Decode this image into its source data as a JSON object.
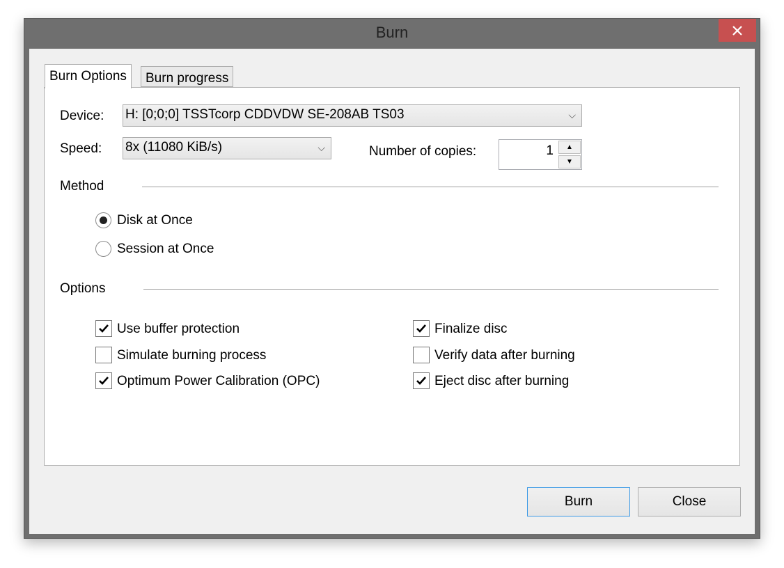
{
  "window": {
    "title": "Burn",
    "close_icon": "close-icon"
  },
  "tabs": [
    {
      "label": "Burn Options",
      "active": true
    },
    {
      "label": "Burn progress",
      "active": false
    }
  ],
  "device": {
    "label": "Device:",
    "value": "H:  [0;0;0] TSSTcorp CDDVDW SE-208AB TS03"
  },
  "speed": {
    "label": "Speed:",
    "value": "8x (11080 KiB/s)"
  },
  "copies": {
    "label": "Number of copies:",
    "value": "1"
  },
  "method": {
    "heading": "Method",
    "options": [
      {
        "label": "Disk at Once",
        "selected": true
      },
      {
        "label": "Session at Once",
        "selected": false
      }
    ]
  },
  "options": {
    "heading": "Options",
    "left": [
      {
        "label": "Use buffer protection",
        "checked": true
      },
      {
        "label": "Simulate burning process",
        "checked": false
      },
      {
        "label": "Optimum Power Calibration (OPC)",
        "checked": true
      }
    ],
    "right": [
      {
        "label": "Finalize disc",
        "checked": true
      },
      {
        "label": "Verify data after burning",
        "checked": false
      },
      {
        "label": "Eject disc after burning",
        "checked": true
      }
    ]
  },
  "buttons": {
    "burn": "Burn",
    "close": "Close"
  },
  "colors": {
    "close_button": "#c75050",
    "default_button_border": "#3c9ae6",
    "titlebar": "#6f6f6f"
  }
}
